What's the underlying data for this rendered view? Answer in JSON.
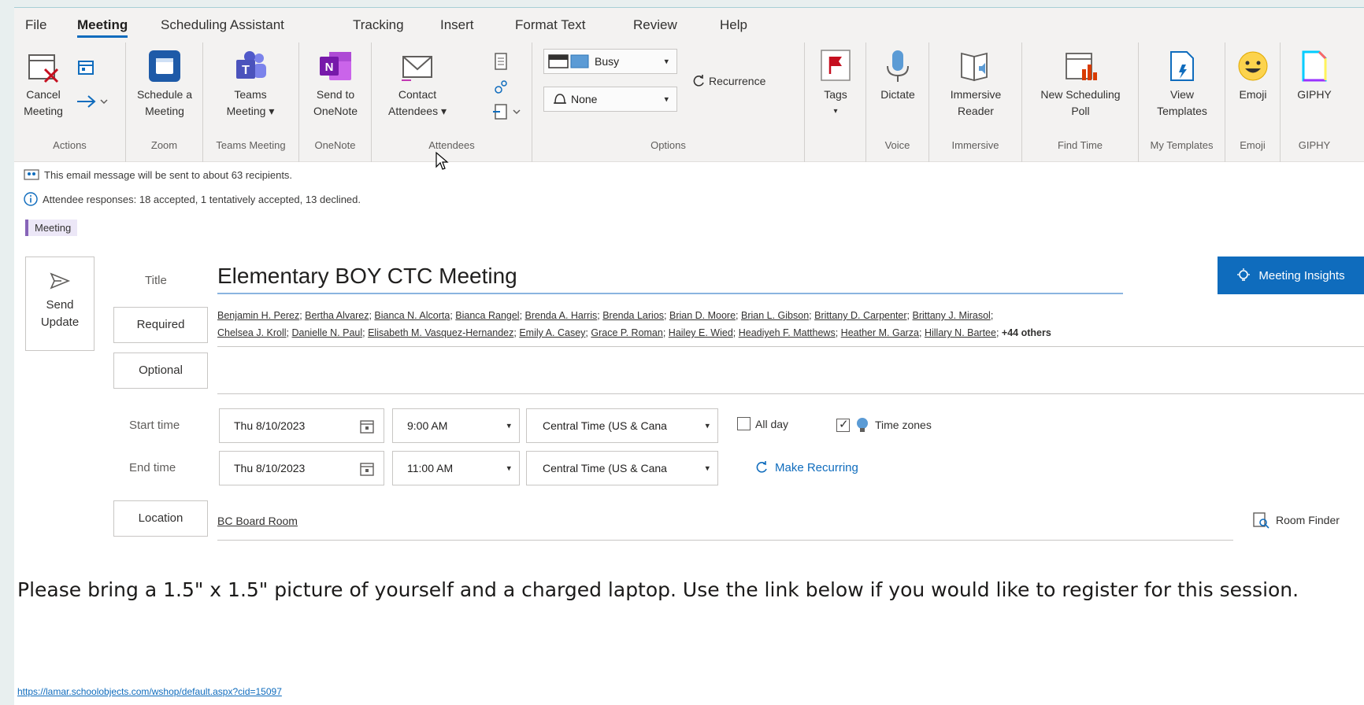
{
  "menu": {
    "tabs": [
      "File",
      "Meeting",
      "Scheduling Assistant",
      "Tracking",
      "Insert",
      "Format Text",
      "Review",
      "Help"
    ],
    "active": "Meeting"
  },
  "ribbon": {
    "actions": {
      "cancel": "Cancel Meeting",
      "group": "Actions"
    },
    "zoom": {
      "schedule": "Schedule a Meeting",
      "group": "Zoom"
    },
    "teams": {
      "meeting": "Teams Meeting ▾",
      "group": "Teams Meeting"
    },
    "onenote": {
      "send": "Send to OneNote",
      "group": "OneNote"
    },
    "attendees": {
      "contact": "Contact Attendees ▾",
      "group": "Attendees"
    },
    "options": {
      "show_as": "Busy",
      "reminder": "None",
      "recurrence": "Recurrence",
      "group": "Options"
    },
    "tags": {
      "label": "Tags"
    },
    "voice": {
      "dictate": "Dictate",
      "group": "Voice"
    },
    "immersive": {
      "reader": "Immersive Reader",
      "group": "Immersive"
    },
    "find_time": {
      "poll": "New Scheduling Poll",
      "group": "Find Time"
    },
    "templates": {
      "view": "View Templates",
      "group": "My Templates"
    },
    "emoji": {
      "label": "Emoji",
      "group": "Emoji"
    },
    "giphy": {
      "label": "GIPHY",
      "group": "GIPHY"
    }
  },
  "info": {
    "recipients": "This email message will be sent to about 63 recipients.",
    "responses": "Attendee responses: 18 accepted, 1 tentatively accepted, 13 declined.",
    "category": "Meeting"
  },
  "form": {
    "send_update": "Send Update",
    "title_label": "Title",
    "title": "Elementary BOY CTC Meeting",
    "insights": "Meeting Insights",
    "required_label": "Required",
    "optional_label": "Optional",
    "attendees_line1": [
      "Benjamin H. Perez",
      "Bertha Alvarez",
      "Bianca N. Alcorta",
      "Bianca Rangel",
      "Brenda A. Harris",
      "Brenda Larios",
      "Brian D. Moore",
      "Brian L. Gibson",
      "Brittany D. Carpenter",
      "Brittany J. Mirasol"
    ],
    "attendees_line2": [
      "Chelsea J. Kroll",
      "Danielle N. Paul",
      "Elisabeth M. Vasquez-Hernandez",
      "Emily A. Casey",
      "Grace P. Roman",
      "Hailey E. Wied",
      "Headiyeh F. Matthews",
      "Heather M. Garza",
      "Hillary N. Bartee"
    ],
    "others": "+44 others",
    "start_label": "Start time",
    "start_date": "Thu 8/10/2023",
    "start_time": "9:00 AM",
    "timezone": "Central Time (US & Cana",
    "all_day": "All day",
    "time_zones": "Time zones",
    "end_label": "End time",
    "end_date": "Thu 8/10/2023",
    "end_time": "11:00 AM",
    "end_timezone": "Central Time (US & Cana",
    "make_recurring": "Make Recurring",
    "location_label": "Location",
    "location": "BC Board Room",
    "room_finder": "Room Finder"
  },
  "body": {
    "text": "Please bring a 1.5\" x 1.5\" picture of yourself and a charged laptop.  Use the link below if you would like to register for this session.",
    "link": "https://lamar.schoolobjects.com/wshop/default.aspx?cid=15097"
  },
  "colors": {
    "accent": "#0f6cbd",
    "category": "#8764b8"
  }
}
